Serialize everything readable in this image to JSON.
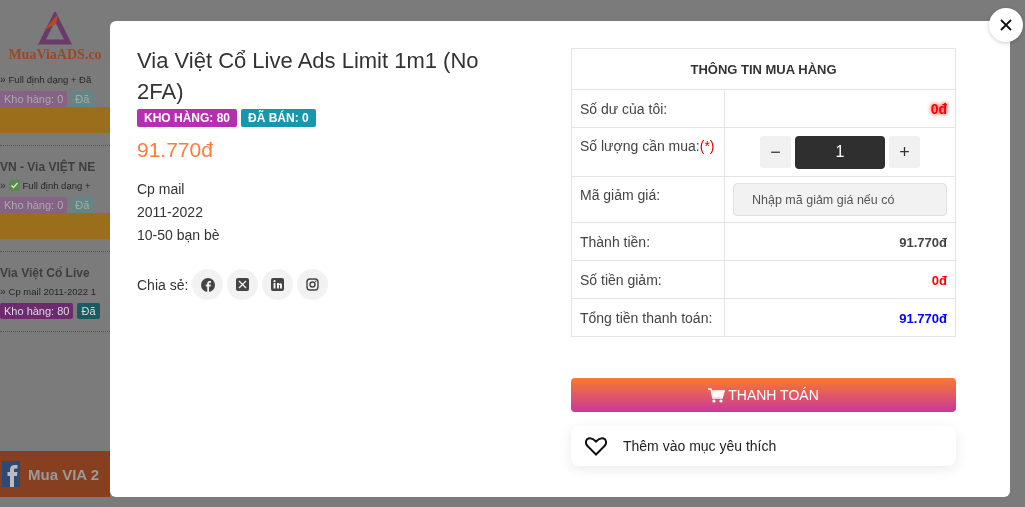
{
  "background_page": {
    "logo": "MuaViaADS.co",
    "items": [
      {
        "bullet": "»",
        "description": "Full định dạng + Đã",
        "verified": false,
        "stock": "Kho hàng: 0",
        "sold": "Đã",
        "out_of_stock": true,
        "has_button": true
      },
      {
        "title": "VN - Via VIỆT NE",
        "bullet": "»",
        "description": "Full định dạng +",
        "verified": true,
        "stock": "Kho hàng: 0",
        "sold": "Đã",
        "out_of_stock": true,
        "has_button": true
      },
      {
        "title": "Via Việt Cổ Live",
        "bullet": "»",
        "description": "Cp mail 2011-2022 1",
        "verified": false,
        "stock": "Kho hàng: 80",
        "sold": "Đã",
        "out_of_stock": false,
        "has_button": false
      }
    ],
    "banner": "Mua VIA 2"
  },
  "product": {
    "title": "Via Việt Cổ Live Ads Limit 1m1 (No 2FA)",
    "stock_badge": "KHO HÀNG: 80",
    "sold_badge": "ĐÃ BÁN: 0",
    "price": "91.770đ",
    "details": [
      "Cp mail",
      "2011-2022",
      "10-50 bạn bè"
    ],
    "share_label": "Chia sẻ:",
    "share_buttons": [
      {
        "kind": "facebook"
      },
      {
        "kind": "x"
      },
      {
        "kind": "linkedin"
      },
      {
        "kind": "instagram"
      }
    ]
  },
  "purchase": {
    "heading": "THÔNG TIN MUA HÀNG",
    "rows": [
      {
        "kind": "balance",
        "label": "Số dư của tôi:",
        "value": "0đ",
        "color": "#ff0000"
      },
      {
        "kind": "quantity",
        "label": "Số lượng cần mua:",
        "required_mark": "(*)",
        "minus": "−",
        "value": "1",
        "plus": "+"
      },
      {
        "kind": "coupon",
        "label": "Mã giảm giá:",
        "placeholder": "Nhập mã giảm giá nếu có"
      },
      {
        "kind": "amount",
        "label": "Thành tiền:",
        "value": "91.770đ",
        "color": "#444444"
      },
      {
        "kind": "amount",
        "label": "Số tiền giảm:",
        "value": "0đ",
        "color": "#ff0000"
      },
      {
        "kind": "amount",
        "label": "Tổng tiền thanh toán:",
        "value": "91.770đ",
        "color": "#0000ff"
      }
    ]
  },
  "checkout_button": "THANH TOÁN",
  "wishlist_button": "Thêm vào mục yêu thích"
}
